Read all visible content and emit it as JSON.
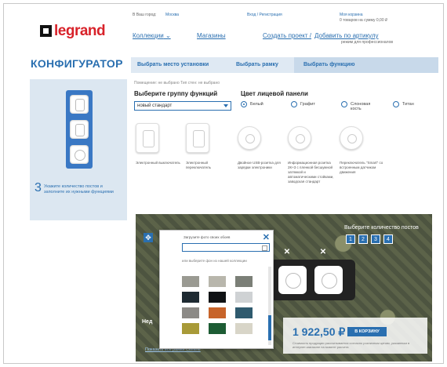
{
  "header": {
    "logo_text": "legrand",
    "city_prefix": "В Ваш город:",
    "city_value": "Москва",
    "login": "Вход / Регистрация",
    "cart_title": "Моя корзина",
    "cart_summary": "0 товаров на сумму 0,00 ₽",
    "nav_collections": "Коллекции",
    "nav_shops": "Магазины",
    "create_project": "Создать проект /",
    "add_by_sku": "Добавить по артикулу",
    "sku_note": "режим для профессионалов"
  },
  "configurator": {
    "title": "КОНФИГУРАТОР",
    "steps": [
      {
        "label": "Выбрать место установки",
        "active": false
      },
      {
        "label": "Выбрать рамку",
        "active": false
      },
      {
        "label": "Выбрать функцию",
        "active": true
      }
    ]
  },
  "left": {
    "step_number": "3",
    "hint": "Укажите количество постов и заполните их нужными функциями"
  },
  "functions": {
    "selection_note": "Помещение: не выбрано  Тип стен: не выбрано",
    "group_heading": "Выберите группу функций",
    "group_value": "новый стандарт",
    "color_heading": "Цвет лицевой панели",
    "colors": [
      {
        "label": "Белый",
        "selected": true
      },
      {
        "label": "Графит",
        "selected": false
      },
      {
        "label": "Слоновая кость",
        "selected": false
      },
      {
        "label": "Титан",
        "selected": false
      }
    ],
    "products": [
      {
        "label": "Электронный выключатель"
      },
      {
        "label": "Электронный переключатель"
      },
      {
        "label": "Двойное USB-розетка для зарядки электроники"
      },
      {
        "label": "Информационная розетка 2К+3 с пленкой бесшумной затяжкой и автоматическими стойками, заводская стандарт"
      },
      {
        "label": "Переключатель \"Smart\" со встроенным датчиком движения"
      }
    ]
  },
  "preview": {
    "qty_label": "Выберите количество постов",
    "qty_options": [
      "1",
      "2",
      "3",
      "4"
    ],
    "price": "1 922,50 ₽",
    "cart_button": "В КОРЗИНУ",
    "price_note": "Стоимость продукции рассчитывается согласно розничным ценам, указанным в интернет-магазине на момент расчета",
    "undo_label": "Нед",
    "show_all": "Показать все рамки Celiane"
  },
  "popup": {
    "title": "Загрузите фото своих обоев",
    "or_text": "или выберите фон из нашей коллекции"
  },
  "colors": {
    "brand_red": "#d8222a",
    "accent_blue": "#2a6fb0",
    "panel_blue": "#dce7f1"
  }
}
